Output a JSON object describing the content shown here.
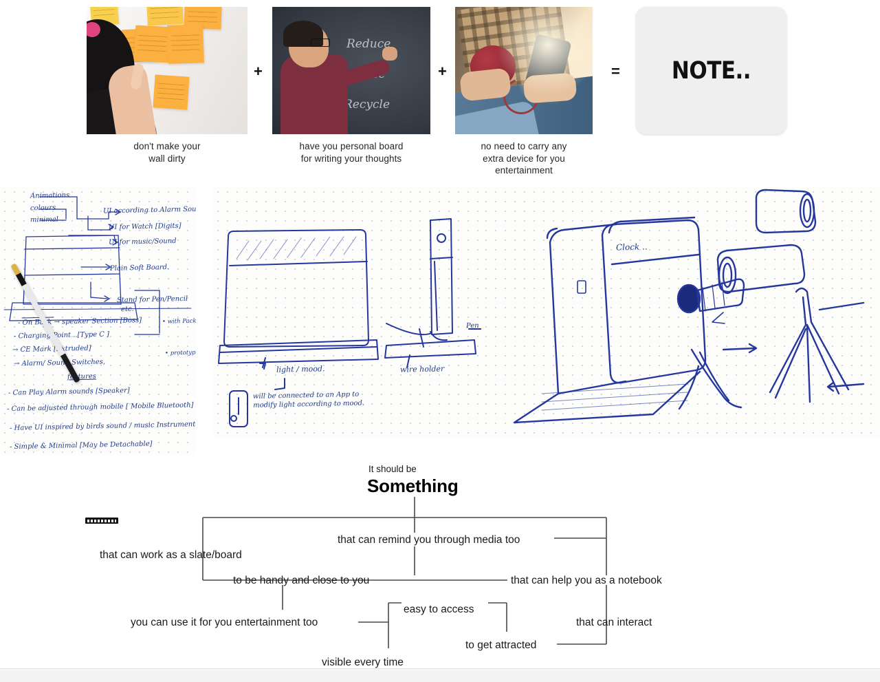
{
  "equation": {
    "items": [
      {
        "id": "sticky-notes",
        "caption_line1": "don't make your",
        "caption_line2": "wall dirty",
        "caption_line3": "",
        "operator_after": "+"
      },
      {
        "id": "blackboard",
        "caption_line1": "have you personal board",
        "caption_line2": "for writing your thoughts",
        "caption_line3": "",
        "operator_after": "+"
      },
      {
        "id": "speaker-phone",
        "caption_line1": "no need to carry any",
        "caption_line2": "extra device for you",
        "caption_line3": "entertainment",
        "operator_after": "="
      }
    ],
    "result": {
      "logo_text": "NOTE..",
      "card_color": "#efefef"
    },
    "blackboard_words": [
      "Reduce",
      "Reuse",
      "Recycle"
    ]
  },
  "sketches": {
    "left": {
      "annotations": [
        "Animations",
        "colours.",
        "minimal",
        "UI according to Alarm Sound",
        "UI for Watch [Digits]",
        "UI for music/Sound",
        "Plain Soft Board.",
        "Stand for Pen/Pencil",
        "etc.",
        "- On Back → speaker Section [Boss]",
        "- Charging Point ..[Type C ]",
        "→ CE Mark [Extruded]",
        "→ Alarm/ Sound Switches,",
        "• with Packaging",
        "• prototyping",
        "features",
        "- Can Play Alarm sounds [Speaker]",
        "- Can be adjusted through mobile [ Mobile Bluetooth] app.",
        "- Have UI inspired by birds sound / music Instrument ].",
        "- Simple & Minimal  [May be Detachable]"
      ]
    },
    "middle": {
      "annotations": [
        "light / mood.",
        "will be connected to an App to modify light according to mood.",
        "wire holder",
        "Pen S"
      ]
    },
    "right": {
      "annotations": [
        "Clock .."
      ]
    }
  },
  "mindmap": {
    "title_small": "It should be",
    "title_big": "Something",
    "nodes": [
      {
        "id": "slate-board",
        "label": "that can work as a slate/board"
      },
      {
        "id": "remind-media",
        "label": "that can remind you through media too"
      },
      {
        "id": "handy-close",
        "label": "to be handy and close to you"
      },
      {
        "id": "help-notebook",
        "label": "that can help you as a notebook"
      },
      {
        "id": "easy-access",
        "label": "easy to access"
      },
      {
        "id": "entertainment",
        "label": "you can use it for you entertainment too"
      },
      {
        "id": "can-interact",
        "label": "that can interact"
      },
      {
        "id": "get-attracted",
        "label": "to get attracted"
      },
      {
        "id": "visible-everytime",
        "label": "visible every time"
      }
    ],
    "line_color": "#4a4a4a"
  }
}
